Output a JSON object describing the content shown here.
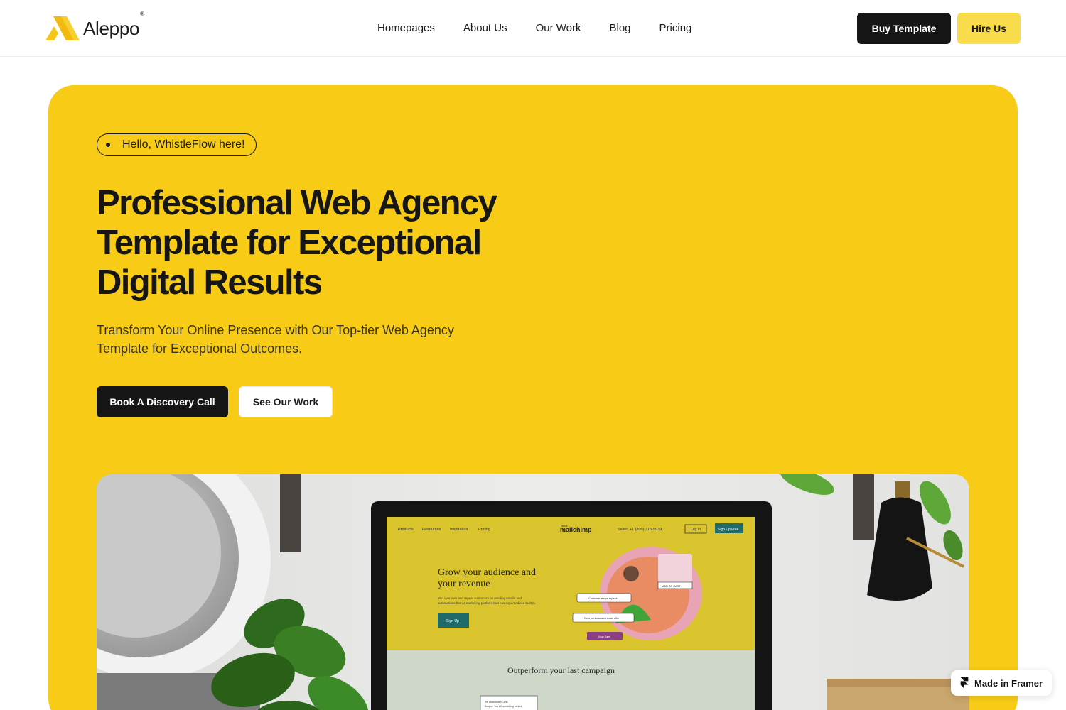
{
  "nav": {
    "logo_text": "Aleppo",
    "logo_mark": "®",
    "links": [
      "Homepages",
      "About Us",
      "Our Work",
      "Blog",
      "Pricing"
    ],
    "buy_label": "Buy Template",
    "hire_label": "Hire Us"
  },
  "hero": {
    "pill_text": "Hello, WhistleFlow here!",
    "title_lines": [
      "Professional Web Agency",
      "Template for Exceptional",
      "Digital Results"
    ],
    "subtitle": "Transform Your Online Presence with Our Top-tier Web Agency Template for Exceptional Outcomes.",
    "primary_cta": "Book A Discovery Call",
    "secondary_cta": "See Our Work"
  },
  "mockup": {
    "nav_items": [
      "Products",
      "Resources",
      "Inspiration",
      "Pricing"
    ],
    "brand_small": "intuit",
    "brand": "mailchimp",
    "sales": "Sales: +1 (800) 315-5939",
    "login": "Log In",
    "signup": "Sign Up Free",
    "headline": [
      "Grow your audience and",
      "your revenue"
    ],
    "body": [
      "Win over new and repeat customers by sending emails and",
      "automations from a marketing platform that has expert advice built in."
    ],
    "cta": "Sign Up",
    "tags": [
      "ADD TO CART",
      "Customer shops my site",
      "Gets personalized email offer",
      "Now Sale!"
    ],
    "section_title": "Outperform your last campaign",
    "card_lines": [
      "Re: Abandoned Carts",
      "Subject: You left something behind"
    ]
  },
  "badge": {
    "label": "Made in Framer"
  },
  "colors": {
    "accent": "#f8cc16",
    "dark": "#161616",
    "hire": "#f9dc4c",
    "mockup_yellow": "#d9c42d",
    "mockup_green": "#cfd8c8"
  },
  "icons": {
    "logo": "aleppo-logo-icon",
    "framer": "framer-icon",
    "pill_dot": "status-dot-icon"
  }
}
